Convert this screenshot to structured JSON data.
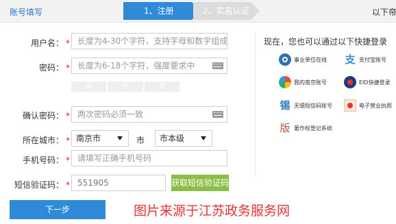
{
  "header": {
    "title": "账号填写",
    "step1": "1、注册",
    "step2": "2、实名认证",
    "next_text": "以下帝"
  },
  "form": {
    "username": {
      "label": "用户名：",
      "required": "*",
      "placeholder": "长度为4-30个字符，支持字母和数字组成"
    },
    "password": {
      "label": "密码：",
      "required": "*",
      "placeholder": "长度为6-18个字符，强度要求中"
    },
    "strength": [
      "弱",
      "中",
      "强"
    ],
    "confirm": {
      "label": "确认密码：",
      "required": "*",
      "placeholder": "两次密码必须一致"
    },
    "city": {
      "label": "所在城市：",
      "required": "*",
      "city_value": "南京市",
      "separator": "市",
      "district_value": "市本级"
    },
    "phone": {
      "label": "手机号码：",
      "required": "*",
      "placeholder": "请填写正确手机号码"
    },
    "sms": {
      "label": "短信验证码：",
      "required": "*",
      "value": "551905",
      "button": "获取短信验证码"
    },
    "next_button": "下一步"
  },
  "quick_login": {
    "title": "现在，您也可以通过以下快捷登录",
    "items": [
      {
        "icon": "unit-circle-icon",
        "label": "事业单位在线"
      },
      {
        "icon": "alipay-icon",
        "label": "支付宝账号"
      },
      {
        "icon": "color-circle-icon",
        "label": "我的南京账号"
      },
      {
        "icon": "eid-icon",
        "label": "EID快捷登录"
      },
      {
        "icon": "sms-login-icon",
        "label": "无锡短信码账号"
      },
      {
        "icon": "business-license-icon",
        "label": "电子营业执照"
      },
      {
        "icon": "copyright-icon",
        "label": "著作权登记系统"
      }
    ]
  },
  "watermark": "图片来源于江苏政务服务网",
  "colors": {
    "primary": "#2f8bd8",
    "sms_button": "#8cbd45",
    "required": "#e02020",
    "watermark": "#e53333"
  }
}
